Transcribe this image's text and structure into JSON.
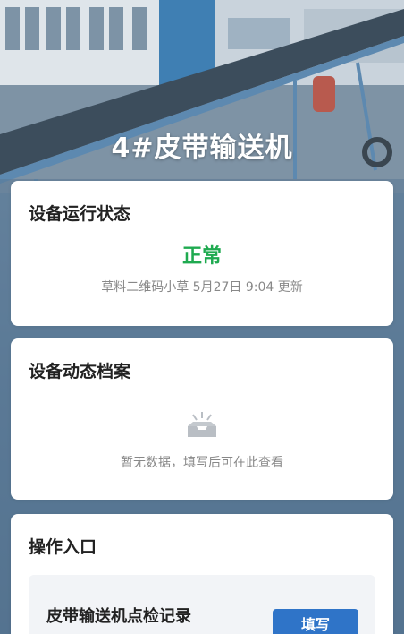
{
  "hero": {
    "title": "4#皮带输送机"
  },
  "status_card": {
    "title": "设备运行状态",
    "status": "正常",
    "note": "草料二维码小草 5月27日 9:04 更新",
    "status_color": "#1faa50"
  },
  "archive_card": {
    "title": "设备动态档案",
    "empty_icon": "empty-inbox-icon",
    "empty_text": "暂无数据，填写后可在此查看"
  },
  "ops_card": {
    "title": "操作入口",
    "entries": [
      {
        "label": "皮带输送机点检记录",
        "button_label": "填写"
      }
    ]
  },
  "colors": {
    "accent": "#2f74c8",
    "ok": "#1faa50"
  }
}
